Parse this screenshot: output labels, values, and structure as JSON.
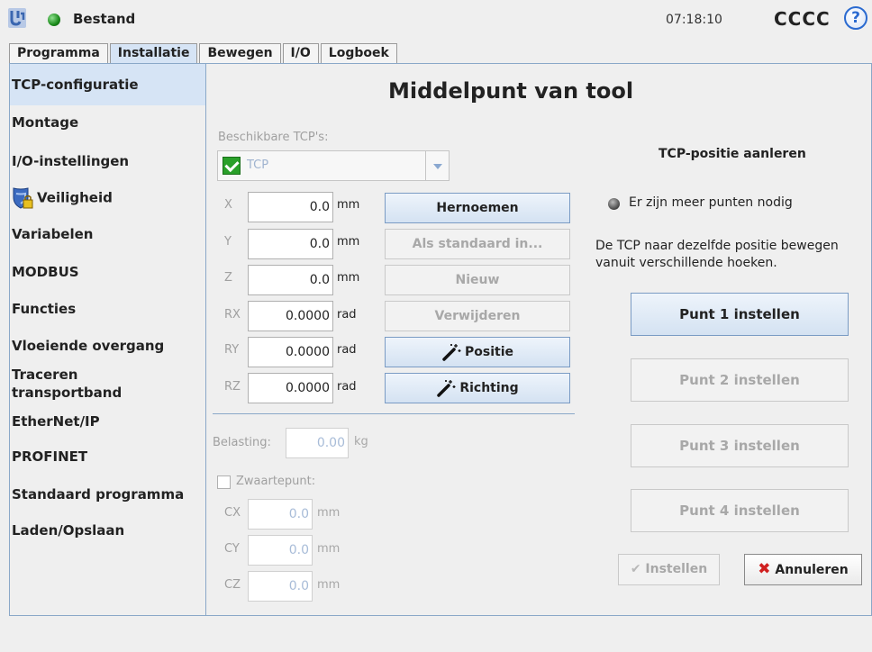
{
  "header": {
    "program_name": "Bestand",
    "time": "07:18:10",
    "user": "CCCC",
    "help_symbol": "?"
  },
  "tabs": [
    {
      "label": "Programma"
    },
    {
      "label": "Installatie"
    },
    {
      "label": "Bewegen"
    },
    {
      "label": "I/O"
    },
    {
      "label": "Logboek"
    }
  ],
  "sidebar": {
    "items": [
      {
        "label": "TCP-configuratie"
      },
      {
        "label": "Montage"
      },
      {
        "label": "I/O-instellingen"
      },
      {
        "label": "Veiligheid"
      },
      {
        "label": "Variabelen"
      },
      {
        "label": "MODBUS"
      },
      {
        "label": "Functies"
      },
      {
        "label": "Vloeiende overgang"
      },
      {
        "label": "Traceren transportband",
        "line1": "Traceren",
        "line2": "transportband"
      },
      {
        "label": "EtherNet/IP"
      },
      {
        "label": "PROFINET"
      },
      {
        "label": "Standaard programma"
      },
      {
        "label": "Laden/Opslaan"
      }
    ]
  },
  "main": {
    "title": "Middelpunt van tool",
    "available_tcps_label": "Beschikbare TCP's:",
    "tcp_selected": "TCP",
    "coords": [
      {
        "label": "X",
        "value": "0.0",
        "unit": "mm"
      },
      {
        "label": "Y",
        "value": "0.0",
        "unit": "mm"
      },
      {
        "label": "Z",
        "value": "0.0",
        "unit": "mm"
      },
      {
        "label": "RX",
        "value": "0.0000",
        "unit": "rad"
      },
      {
        "label": "RY",
        "value": "0.0000",
        "unit": "rad"
      },
      {
        "label": "RZ",
        "value": "0.0000",
        "unit": "rad"
      }
    ],
    "buttons": {
      "rename": "Hernoemen",
      "set_default": "Als standaard in...",
      "new": "Nieuw",
      "delete": "Verwijderen",
      "position": "Positie",
      "orientation": "Richting"
    },
    "payload": {
      "label": "Belasting:",
      "value": "0.00",
      "unit": "kg"
    },
    "cog": {
      "label": "Zwaartepunt:",
      "checked": false,
      "fields": [
        {
          "label": "CX",
          "value": "0.0",
          "unit": "mm"
        },
        {
          "label": "CY",
          "value": "0.0",
          "unit": "mm"
        },
        {
          "label": "CZ",
          "value": "0.0",
          "unit": "mm"
        }
      ]
    }
  },
  "teach": {
    "heading": "TCP-positie aanleren",
    "status": "Er zijn meer punten nodig",
    "instruction_line1": "De TCP naar dezelfde positie bewegen",
    "instruction_line2": "vanuit verschillende hoeken.",
    "points": [
      {
        "label": "Punt 1 instellen",
        "enabled": true
      },
      {
        "label": "Punt 2 instellen",
        "enabled": false
      },
      {
        "label": "Punt 3 instellen",
        "enabled": false
      },
      {
        "label": "Punt 4 instellen",
        "enabled": false
      }
    ],
    "set_label": "Instellen",
    "cancel_label": "Annuleren"
  },
  "colors": {
    "accent": "#d6e4f5",
    "border": "#8aa8c8",
    "status_green": "#1a8a1a",
    "cancel_red": "#d02020"
  }
}
